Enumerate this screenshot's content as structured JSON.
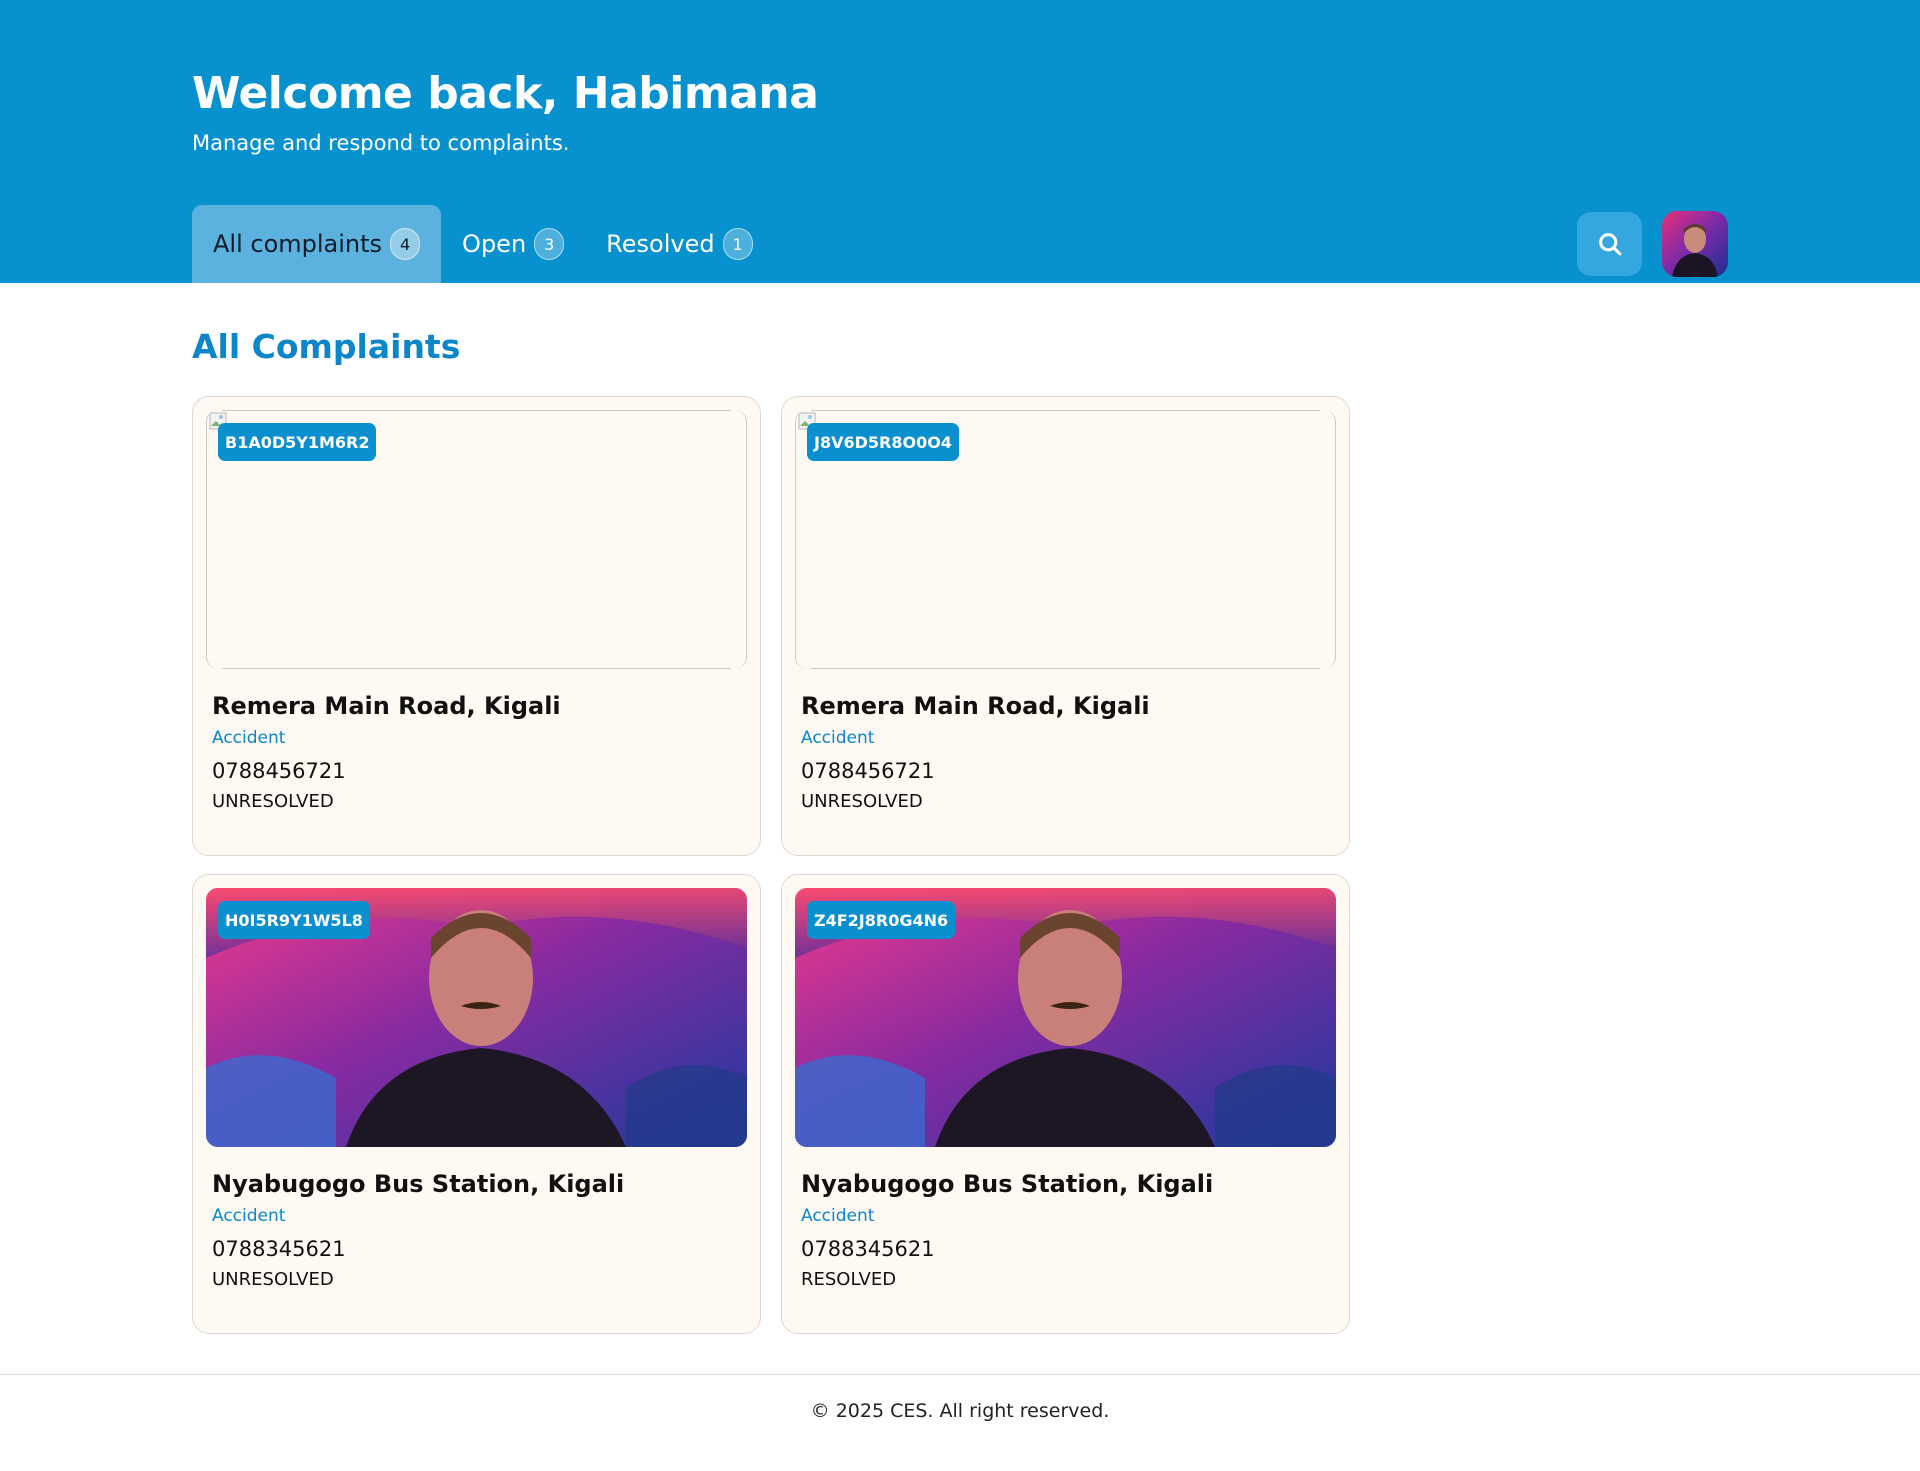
{
  "header": {
    "welcome": "Welcome back, Habimana",
    "subtitle": "Manage and respond to complaints."
  },
  "tabs": [
    {
      "label": "All complaints",
      "count": "4"
    },
    {
      "label": "Open",
      "count": "3"
    },
    {
      "label": "Resolved",
      "count": "1"
    }
  ],
  "section_title": "All Complaints",
  "complaints": [
    {
      "id": "B1A0D5Y1M6R2",
      "location": "Remera Main Road, Kigali",
      "category": "Accident",
      "phone": "0788456721",
      "status": "UNRESOLVED"
    },
    {
      "id": "J8V6D5R8O0O4",
      "location": "Remera Main Road, Kigali",
      "category": "Accident",
      "phone": "0788456721",
      "status": "UNRESOLVED"
    },
    {
      "id": "H0I5R9Y1W5L8",
      "location": "Nyabugogo Bus Station, Kigali",
      "category": "Accident",
      "phone": "0788345621",
      "status": "UNRESOLVED"
    },
    {
      "id": "Z4F2J8R0G4N6",
      "location": "Nyabugogo Bus Station, Kigali",
      "category": "Accident",
      "phone": "0788345621",
      "status": "RESOLVED"
    }
  ],
  "footer": {
    "text": "© 2025 CES. All right reserved."
  },
  "icons": {
    "search": "search-icon",
    "broken_image": "broken-image-icon"
  },
  "colors": {
    "header_bg": "#0891cf",
    "active_tab_bg": "#5cb2de",
    "accent": "#0a86c9",
    "card_bg": "#fef9f3"
  }
}
